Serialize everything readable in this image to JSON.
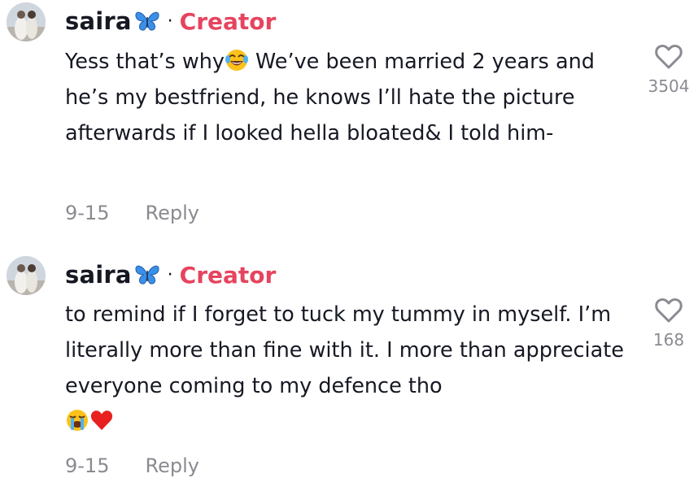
{
  "comments": [
    {
      "username": "saira",
      "badge_separator": "·",
      "badge": "Creator",
      "text_before_emoji": "Yess that’s why",
      "text_after_emoji": " We’ve been married 2 years and he’s my bestfriend, he knows I’ll hate the picture afterwards if I looked hella bloated& I told him-",
      "emoji": "face-with-tears-of-joy",
      "date": "9-15",
      "reply_label": "Reply",
      "like_count": "3504"
    },
    {
      "username": "saira",
      "badge_separator": "·",
      "badge": "Creator",
      "text": "to remind if I forget to tuck my tummy in myself. I’m literally more than fine with it. I more than appreciate everyone coming to my defence tho",
      "emoji": [
        "loudly-crying-face",
        "red-heart"
      ],
      "date": "9-15",
      "reply_label": "Reply",
      "like_count": "168"
    }
  ],
  "colors": {
    "username": "#161823",
    "creator_badge": "#e6445e",
    "secondary_text": "#8a8b91",
    "butterfly": "#3b8fe6"
  }
}
